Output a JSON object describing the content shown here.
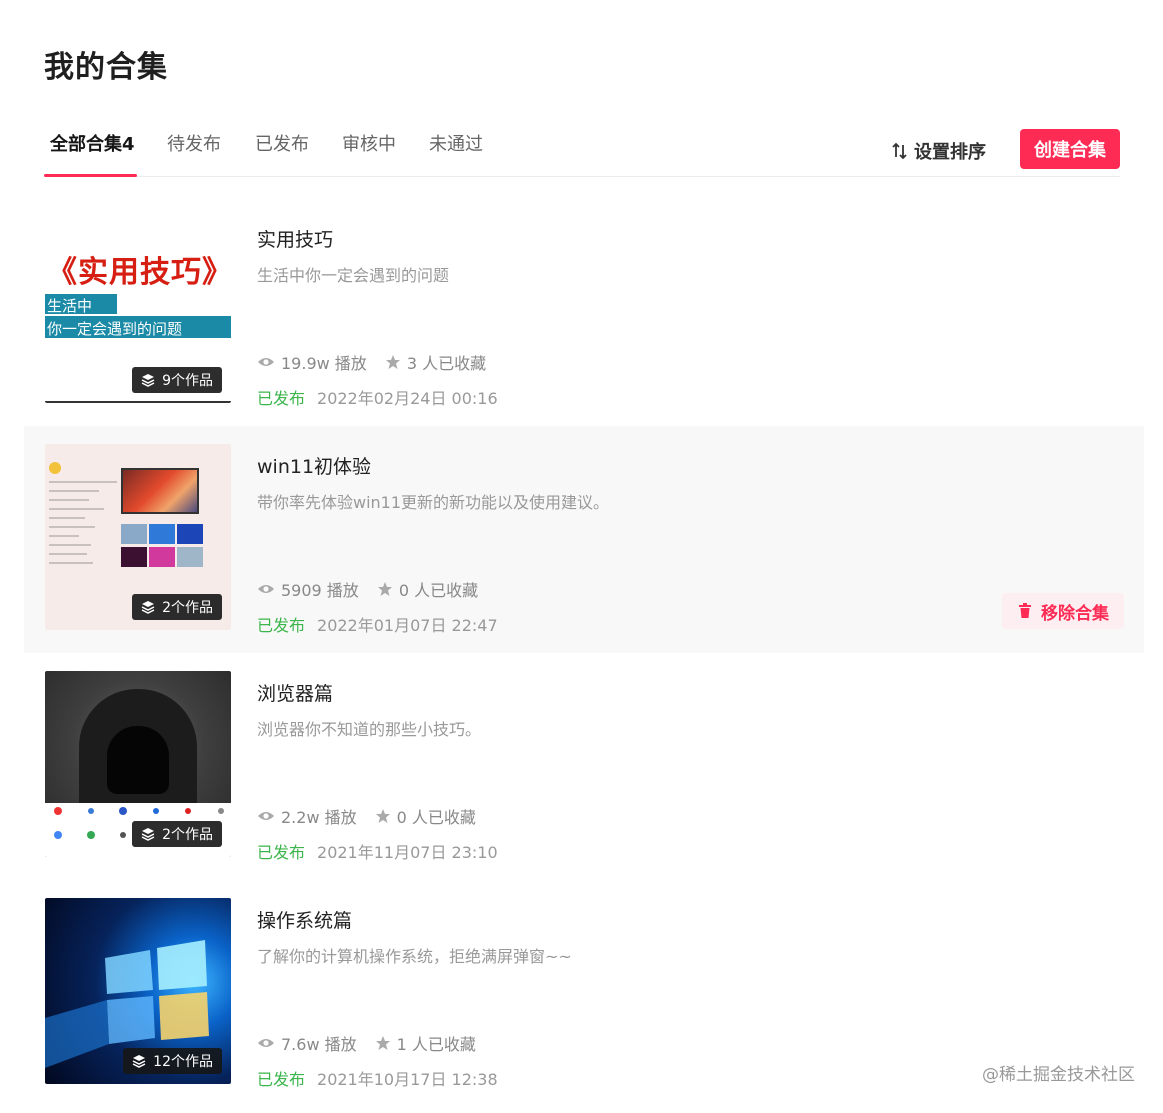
{
  "page": {
    "title": "我的合集"
  },
  "tabs": [
    {
      "label": "全部合集4",
      "active": true
    },
    {
      "label": "待发布",
      "active": false
    },
    {
      "label": "已发布",
      "active": false
    },
    {
      "label": "审核中",
      "active": false
    },
    {
      "label": "未通过",
      "active": false
    }
  ],
  "toolbar": {
    "sort_label": "设置排序",
    "create_label": "创建合集"
  },
  "collections": [
    {
      "title": "实用技巧",
      "desc": "生活中你一定会遇到的问题",
      "count": "9个作品",
      "plays": "19.9w 播放",
      "favs": "3 人已收藏",
      "status": "已发布",
      "date": "2022年02月24日 00:16",
      "thumb_text": {
        "big": "《实用技巧》",
        "line1": "生活中",
        "line2": "你一定会遇到的问题"
      }
    },
    {
      "title": "win11初体验",
      "desc": "带你率先体验win11更新的新功能以及使用建议。",
      "count": "2个作品",
      "plays": "5909 播放",
      "favs": "0 人已收藏",
      "status": "已发布",
      "date": "2022年01月07日 22:47",
      "remove_label": "移除合集"
    },
    {
      "title": "浏览器篇",
      "desc": "浏览器你不知道的那些小技巧。",
      "count": "2个作品",
      "plays": "2.2w 播放",
      "favs": "0 人已收藏",
      "status": "已发布",
      "date": "2021年11月07日 23:10"
    },
    {
      "title": "操作系统篇",
      "desc": "了解你的计算机操作系统，拒绝满屏弹窗~~",
      "count": "12个作品",
      "plays": "7.6w 播放",
      "favs": "1 人已收藏",
      "status": "已发布",
      "date": "2021年10月17日 12:38"
    }
  ],
  "watermark": "@稀土掘金技术社区",
  "colors": {
    "accent": "#fe2c55",
    "published": "#3cb54c",
    "muted": "#999999"
  }
}
